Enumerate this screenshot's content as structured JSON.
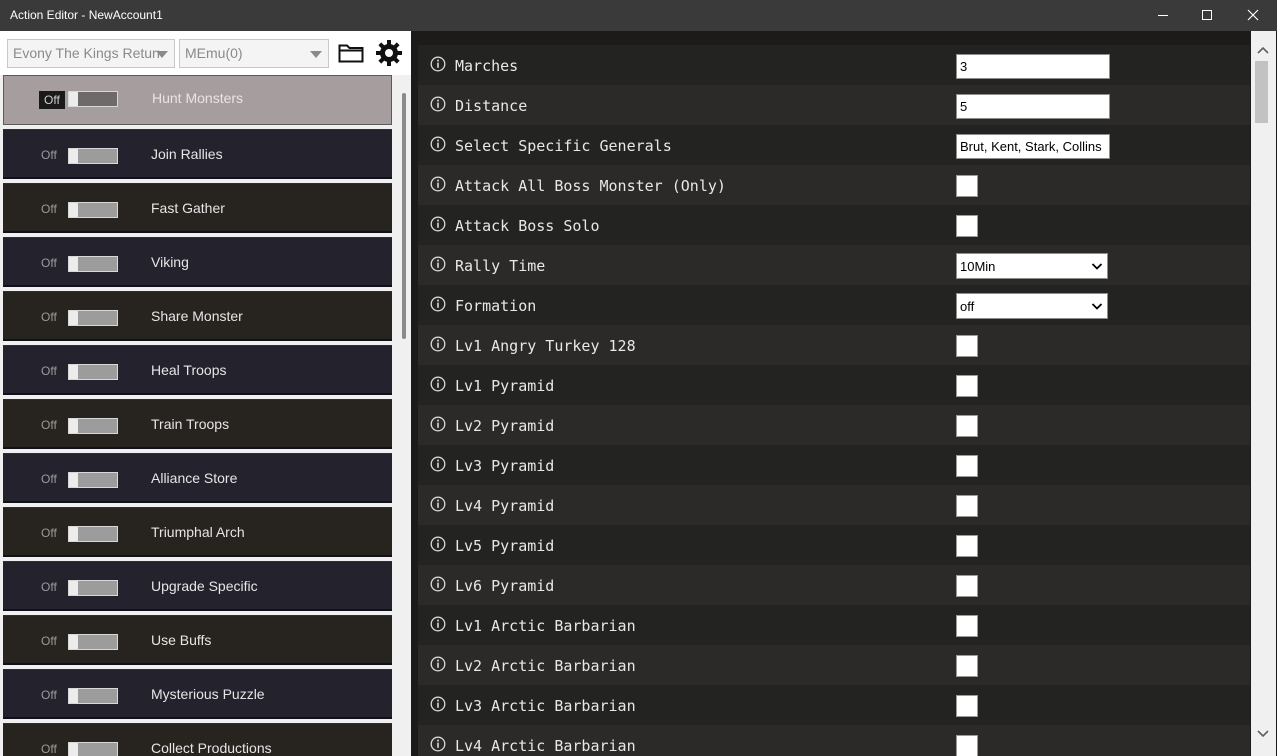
{
  "window": {
    "title": "Action Editor - NewAccount1",
    "controls": {
      "minimize": "minimize-icon",
      "maximize": "maximize-icon",
      "close": "close-icon"
    }
  },
  "toolbar": {
    "game_select": "Evony The Kings Return",
    "emulator_select": "MEmu(0)",
    "folder_icon": "folder-icon",
    "settings_icon": "gear-icon"
  },
  "actions": [
    {
      "label": "Hunt Monsters",
      "state": "Off",
      "selected": true
    },
    {
      "label": "Join Rallies",
      "state": "Off"
    },
    {
      "label": "Fast Gather",
      "state": "Off"
    },
    {
      "label": "Viking",
      "state": "Off"
    },
    {
      "label": "Share Monster",
      "state": "Off"
    },
    {
      "label": "Heal Troops",
      "state": "Off"
    },
    {
      "label": "Train Troops",
      "state": "Off"
    },
    {
      "label": "Alliance Store",
      "state": "Off"
    },
    {
      "label": "Triumphal Arch",
      "state": "Off"
    },
    {
      "label": "Upgrade Specific",
      "state": "Off"
    },
    {
      "label": "Use Buffs",
      "state": "Off"
    },
    {
      "label": "Mysterious Puzzle",
      "state": "Off"
    },
    {
      "label": "Collect Productions",
      "state": "Off"
    }
  ],
  "settings": [
    {
      "label": "Marches",
      "control": "text",
      "value": "3"
    },
    {
      "label": "Distance",
      "control": "text",
      "value": "5"
    },
    {
      "label": "Select Specific Generals",
      "control": "text",
      "value": "Brut, Kent, Stark, Collins"
    },
    {
      "label": "Attack All Boss Monster (Only)",
      "control": "checkbox",
      "checked": false
    },
    {
      "label": "Attack Boss Solo",
      "control": "checkbox",
      "checked": false
    },
    {
      "label": "Rally Time",
      "control": "select",
      "value": "10Min"
    },
    {
      "label": "Formation",
      "control": "select",
      "value": "off"
    },
    {
      "label": "Lv1 Angry Turkey 128",
      "control": "checkbox",
      "checked": false
    },
    {
      "label": "Lv1 Pyramid",
      "control": "checkbox",
      "checked": false
    },
    {
      "label": "Lv2 Pyramid",
      "control": "checkbox",
      "checked": false
    },
    {
      "label": "Lv3 Pyramid",
      "control": "checkbox",
      "checked": false
    },
    {
      "label": "Lv4 Pyramid",
      "control": "checkbox",
      "checked": false
    },
    {
      "label": "Lv5 Pyramid",
      "control": "checkbox",
      "checked": false
    },
    {
      "label": "Lv6 Pyramid",
      "control": "checkbox",
      "checked": false
    },
    {
      "label": "Lv1 Arctic Barbarian",
      "control": "checkbox",
      "checked": false
    },
    {
      "label": "Lv2 Arctic Barbarian",
      "control": "checkbox",
      "checked": false
    },
    {
      "label": "Lv3 Arctic Barbarian",
      "control": "checkbox",
      "checked": false
    },
    {
      "label": "Lv4 Arctic Barbarian",
      "control": "checkbox",
      "checked": false
    }
  ],
  "colors": {
    "selected_item": "#a69e9e",
    "panel_bg": "#1c1b1a",
    "row_bg": "#232322",
    "row_alt_bg": "#2b2a29"
  }
}
